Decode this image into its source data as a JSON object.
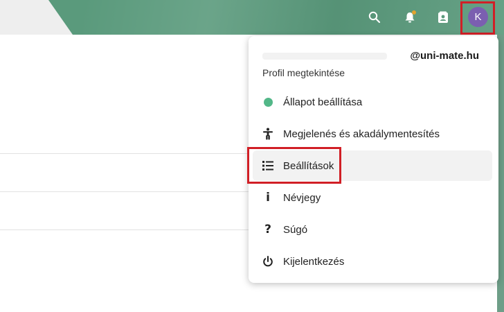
{
  "header": {
    "search_icon": "search-icon",
    "notifications_icon": "bell-icon",
    "contacts_icon": "contacts-icon",
    "avatar_initial": "K",
    "accent_color": "#5a9a7c",
    "avatar_color": "#7b5fb0",
    "notification_dot_color": "#e3a32e"
  },
  "menu": {
    "email": "@uni-mate.hu",
    "profile_label": "Profil megtekintése",
    "items": [
      {
        "label": "Állapot beállítása",
        "icon": "status-dot-icon"
      },
      {
        "label": "Megjelenés és akadálymentesítés",
        "icon": "accessibility-icon"
      },
      {
        "label": "Beállítások",
        "icon": "settings-list-icon"
      },
      {
        "label": "Névjegy",
        "icon": "info-icon"
      },
      {
        "label": "Súgó",
        "icon": "help-icon"
      },
      {
        "label": "Kijelentkezés",
        "icon": "power-icon"
      }
    ],
    "status_color": "#52b788",
    "highlight_color": "#d11f26"
  }
}
